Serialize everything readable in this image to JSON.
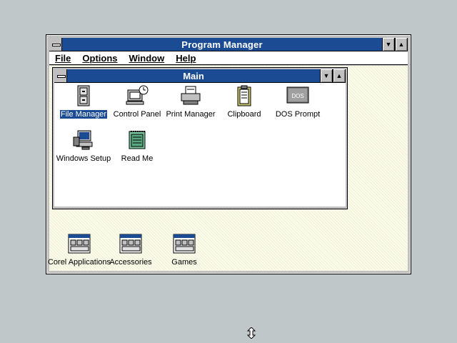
{
  "program_manager": {
    "title": "Program Manager",
    "minimize_glyph": "▼",
    "maximize_glyph": "▲",
    "menu": [
      "File",
      "Options",
      "Window",
      "Help"
    ]
  },
  "main_group": {
    "title": "Main",
    "minimize_glyph": "▼",
    "maximize_glyph": "▲",
    "programs": [
      {
        "label": "File Manager",
        "icon": "file-cabinet-icon",
        "selected": true
      },
      {
        "label": "Control Panel",
        "icon": "control-panel-icon"
      },
      {
        "label": "Print Manager",
        "icon": "printer-icon"
      },
      {
        "label": "Clipboard",
        "icon": "clipboard-icon"
      },
      {
        "label": "DOS Prompt",
        "icon": "dos-prompt-icon",
        "icon_text": "DOS"
      },
      {
        "label": "Windows Setup",
        "icon": "windows-setup-icon"
      },
      {
        "label": "Read Me",
        "icon": "notepad-icon"
      }
    ]
  },
  "group_icons": [
    {
      "label": "Corel Applications",
      "icon": "program-group-icon"
    },
    {
      "label": "Accessories",
      "icon": "program-group-icon"
    },
    {
      "label": "Games",
      "icon": "program-group-icon"
    }
  ],
  "cursor": {
    "icon": "resize-vertical-cursor-icon"
  },
  "colors": {
    "titlebar": "#1b4b92",
    "desktop": "#c0c7c8",
    "workspace": "#fbfbea"
  }
}
